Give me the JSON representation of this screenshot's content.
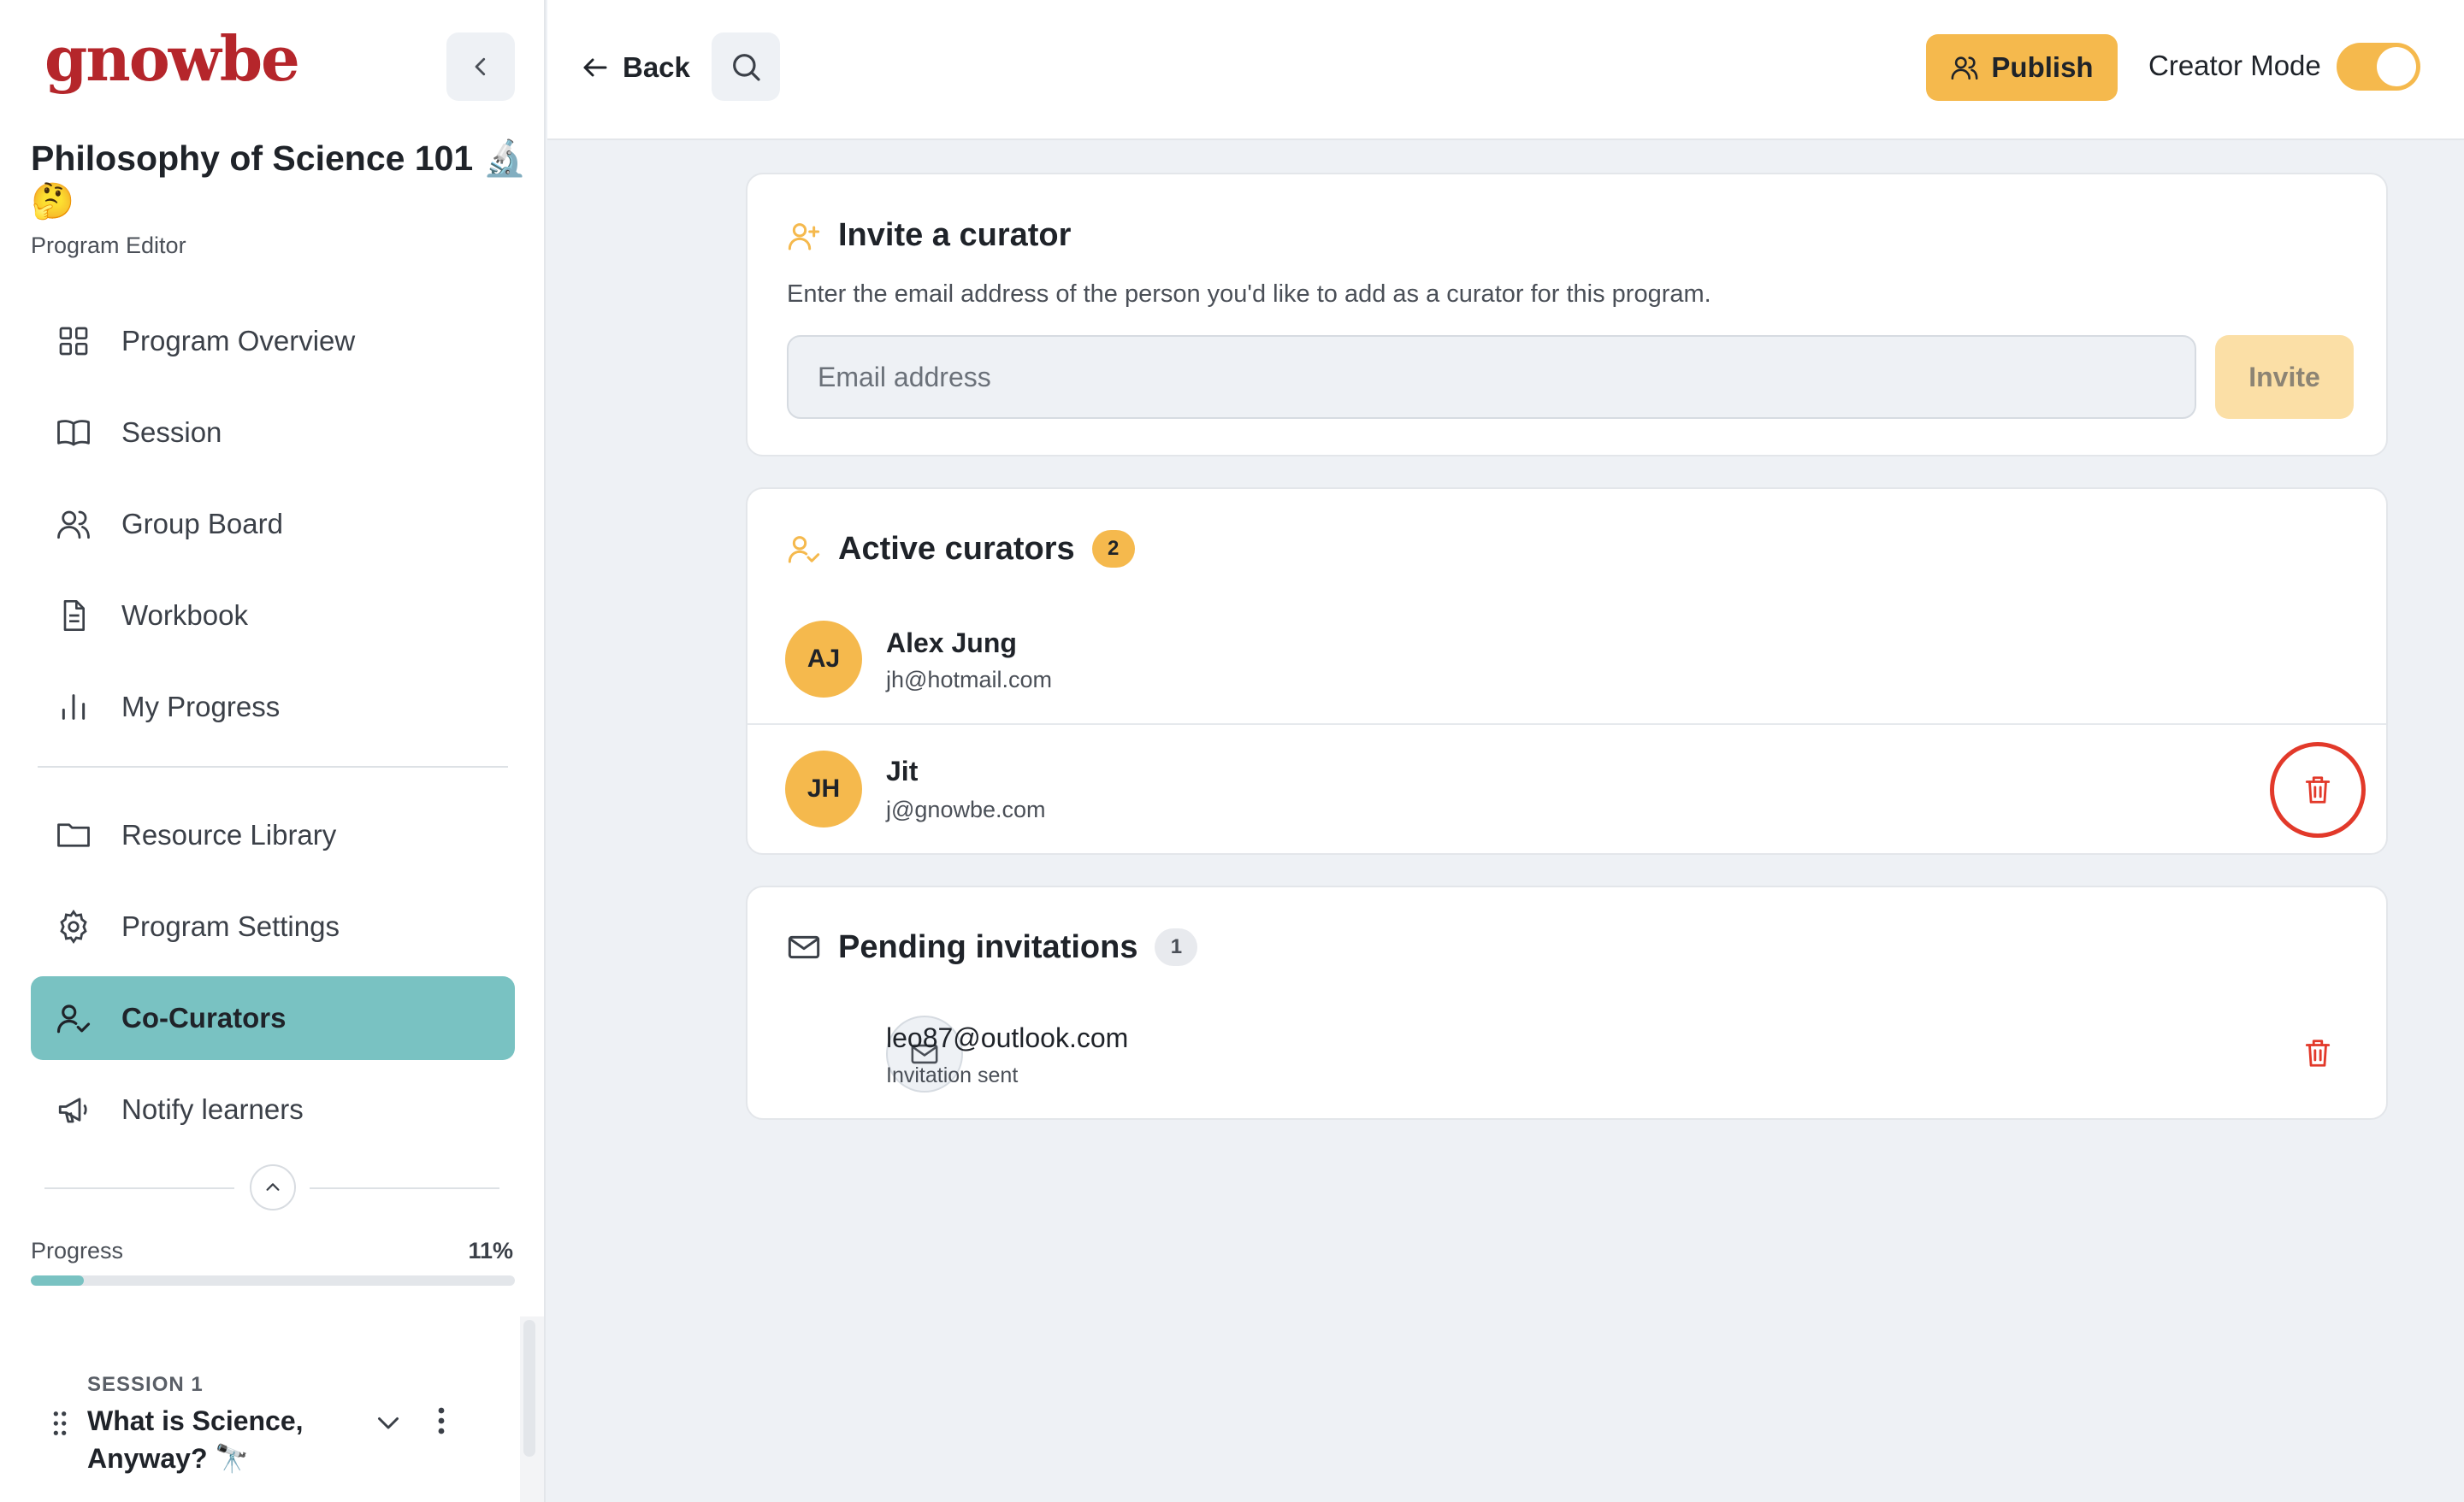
{
  "app": {
    "logo": "gnowbe"
  },
  "sidebar": {
    "program_title": "Philosophy of Science 101 🔬 🤔",
    "program_subtitle": "Program Editor",
    "items": [
      {
        "label": "Program Overview",
        "icon": "grid-icon"
      },
      {
        "label": "Session",
        "icon": "book-icon"
      },
      {
        "label": "Group Board",
        "icon": "users-icon"
      },
      {
        "label": "Workbook",
        "icon": "document-icon"
      },
      {
        "label": "My Progress",
        "icon": "bar-chart-icon"
      }
    ],
    "items2": [
      {
        "label": "Resource Library",
        "icon": "folder-icon"
      },
      {
        "label": "Program Settings",
        "icon": "gear-icon"
      },
      {
        "label": "Co-Curators",
        "icon": "user-check-icon",
        "active": true
      },
      {
        "label": "Notify learners",
        "icon": "megaphone-icon"
      }
    ],
    "progress": {
      "label": "Progress",
      "value_text": "11%",
      "value": 0.11
    },
    "session": {
      "tag": "SESSION 1",
      "name": "What is Science, Anyway? 🔭"
    }
  },
  "topbar": {
    "back_label": "Back",
    "publish_label": "Publish",
    "creator_mode_label": "Creator Mode",
    "creator_mode_on": true
  },
  "invite": {
    "title": "Invite a curator",
    "description": "Enter the email address of the person you'd like to add as a curator for this program.",
    "email_placeholder": "Email address",
    "button_label": "Invite"
  },
  "active": {
    "title": "Active curators",
    "count": "2",
    "curators": [
      {
        "initials": "AJ",
        "name": "Alex Jung",
        "email": "jh@hotmail.com"
      },
      {
        "initials": "JH",
        "name": "Jit",
        "email": "j@gnowbe.com"
      }
    ]
  },
  "pending": {
    "title": "Pending invitations",
    "count": "1",
    "invitations": [
      {
        "email": "leo87@outlook.com",
        "status": "Invitation sent"
      }
    ]
  },
  "colors": {
    "accent_orange": "#f5b94d",
    "active_teal": "#79c2c2",
    "danger_red": "#e2392a",
    "brand_red": "#b5262b"
  }
}
